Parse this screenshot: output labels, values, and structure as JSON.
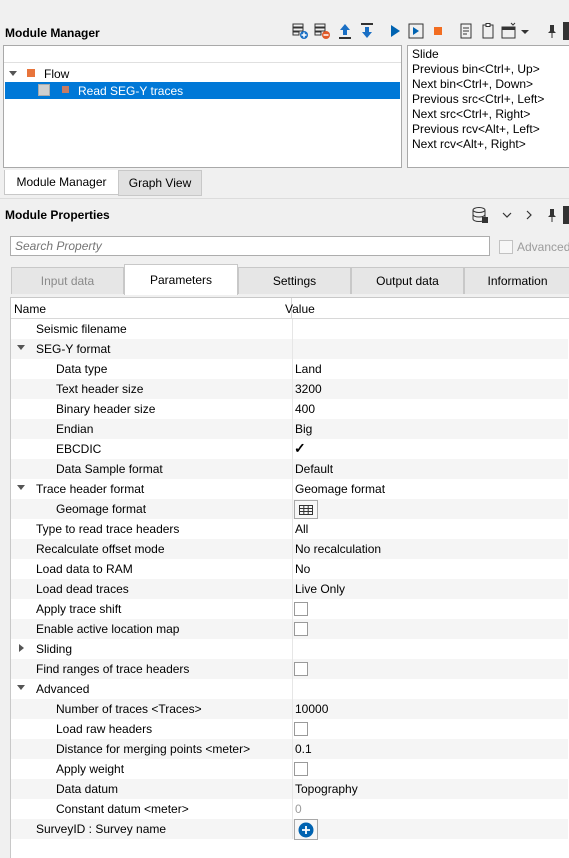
{
  "module_manager": {
    "title": "Module Manager",
    "flow": {
      "label": "Flow",
      "modules": [
        {
          "label": "Read SEG-Y traces",
          "selected": true
        }
      ]
    },
    "hints": [
      "Slide",
      "Previous bin<Ctrl+, Up>",
      "Next bin<Ctrl+, Down>",
      "Previous src<Ctrl+, Left>",
      "Next src<Ctrl+, Right>",
      "Previous rcv<Alt+, Left>",
      "Next rcv<Alt+, Right>"
    ],
    "bottom_tabs": [
      "Module Manager",
      "Graph View"
    ],
    "active_bottom_tab": "Module Manager"
  },
  "module_properties": {
    "title": "Module Properties",
    "search_placeholder": "Search Property",
    "advanced_label": "Advanced",
    "tabs": [
      "Input data",
      "Parameters",
      "Settings",
      "Output data",
      "Information"
    ],
    "active_tab": "Parameters",
    "columns": {
      "name": "Name",
      "value": "Value"
    },
    "rows": [
      {
        "name": "Seismic filename",
        "value": "",
        "level": 1,
        "expander": ""
      },
      {
        "name": "SEG-Y format",
        "value": "",
        "level": 1,
        "expander": "down"
      },
      {
        "name": "Data type",
        "value": "Land",
        "level": 2
      },
      {
        "name": "Text header size",
        "value": "3200",
        "level": 2
      },
      {
        "name": "Binary header size",
        "value": "400",
        "level": 2
      },
      {
        "name": "Endian",
        "value": "Big",
        "level": 2
      },
      {
        "name": "EBCDIC",
        "value": "",
        "level": 2,
        "widget": "checkbox",
        "checked": true
      },
      {
        "name": "Data Sample format",
        "value": "Default",
        "level": 2
      },
      {
        "name": "Trace header format",
        "value": "Geomage format",
        "level": 1,
        "expander": "down"
      },
      {
        "name": "Geomage format",
        "value": "",
        "level": 2,
        "widget": "table-icon"
      },
      {
        "name": "Type to read trace headers",
        "value": "All",
        "level": 1
      },
      {
        "name": "Recalculate offset mode",
        "value": "No recalculation",
        "level": 1
      },
      {
        "name": "Load data to RAM",
        "value": "No",
        "level": 1
      },
      {
        "name": "Load dead traces",
        "value": "Live Only",
        "level": 1
      },
      {
        "name": "Apply trace shift",
        "value": "",
        "level": 1,
        "widget": "checkbox",
        "checked": false
      },
      {
        "name": "Enable active location map",
        "value": "",
        "level": 1,
        "widget": "checkbox",
        "checked": false
      },
      {
        "name": "Sliding",
        "value": "",
        "level": 1,
        "expander": "right"
      },
      {
        "name": "Find ranges of trace headers",
        "value": "",
        "level": 1,
        "widget": "checkbox",
        "checked": false
      },
      {
        "name": "Advanced",
        "value": "",
        "level": 1,
        "expander": "down"
      },
      {
        "name": "Number of traces <Traces>",
        "value": "10000",
        "level": 2
      },
      {
        "name": "Load raw headers",
        "value": "",
        "level": 2,
        "widget": "checkbox",
        "checked": false
      },
      {
        "name": "Distance for merging points <meter>",
        "value": "0.1",
        "level": 2
      },
      {
        "name": "Apply weight",
        "value": "",
        "level": 2,
        "widget": "checkbox",
        "checked": false
      },
      {
        "name": "Data datum",
        "value": "Topography",
        "level": 2
      },
      {
        "name": "Constant datum <meter>",
        "value": "0",
        "level": 2,
        "disabled": true
      },
      {
        "name": "SurveyID : Survey name",
        "value": "",
        "level": 1,
        "widget": "plus-button"
      }
    ]
  },
  "icons": {
    "toolbar": [
      "add-module-icon",
      "remove-module-icon",
      "move-up-icon",
      "move-down-icon",
      "run-icon",
      "run-step-icon",
      "stop-icon",
      "document-icon",
      "clipboard-icon",
      "window-icon",
      "dropdown-icon",
      "pin-icon"
    ],
    "properties_toolbar": [
      "database-icon",
      "chevron-down-icon",
      "chevron-right-icon",
      "pin-icon"
    ]
  },
  "colors": {
    "selection": "#0078d7",
    "accent_blue": "#0063b1",
    "stop_orange": "#f26d21",
    "flow_orange": "#e8743b",
    "zebra": "#f5f5f5"
  }
}
